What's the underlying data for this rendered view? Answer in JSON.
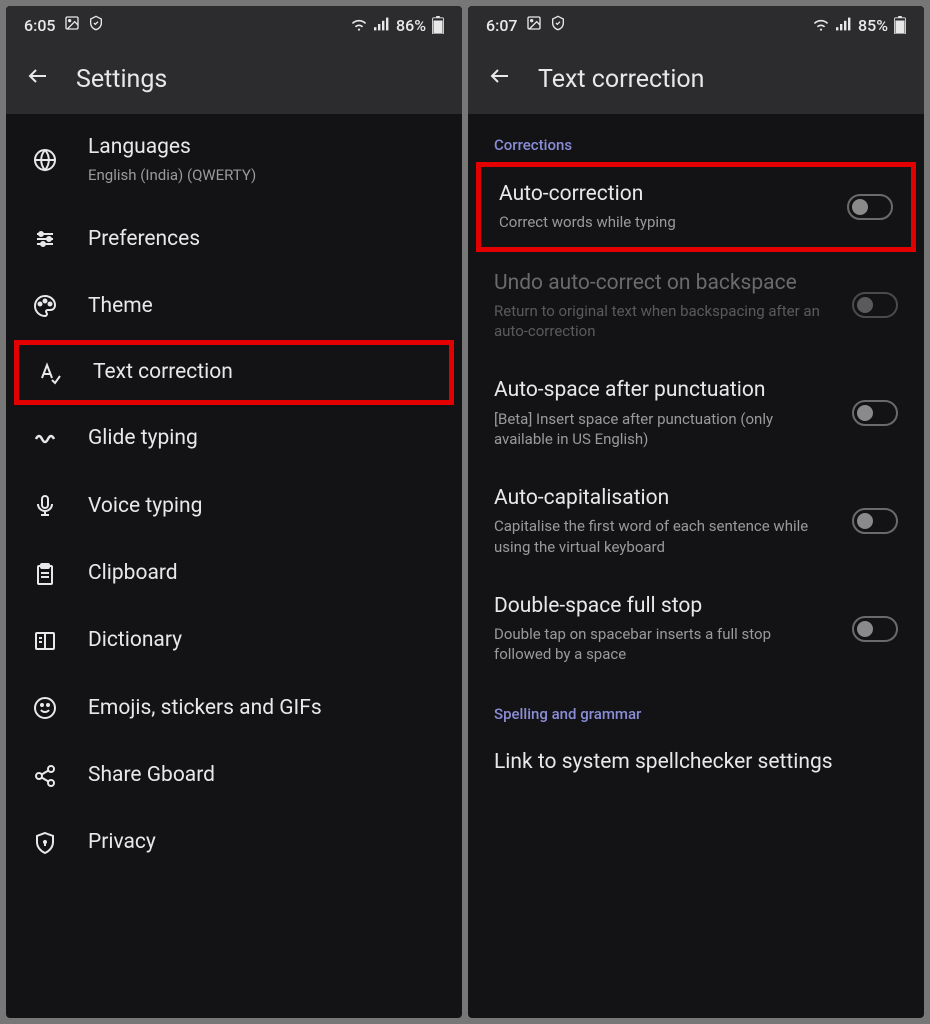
{
  "left": {
    "statusTime": "6:05",
    "batteryPct": "86%",
    "appTitle": "Settings",
    "items": [
      {
        "title": "Languages",
        "sub": "English (India) (QWERTY)",
        "icon": "globe"
      },
      {
        "title": "Preferences",
        "icon": "sliders"
      },
      {
        "title": "Theme",
        "icon": "palette"
      },
      {
        "title": "Text correction",
        "icon": "textcheck",
        "highlight": true
      },
      {
        "title": "Glide typing",
        "icon": "squiggle"
      },
      {
        "title": "Voice typing",
        "icon": "mic"
      },
      {
        "title": "Clipboard",
        "icon": "clipboard"
      },
      {
        "title": "Dictionary",
        "icon": "book"
      },
      {
        "title": "Emojis, stickers and GIFs",
        "icon": "emoji"
      },
      {
        "title": "Share Gboard",
        "icon": "share"
      },
      {
        "title": "Privacy",
        "icon": "shield"
      }
    ]
  },
  "right": {
    "statusTime": "6:07",
    "batteryPct": "85%",
    "appTitle": "Text correction",
    "section1": "Corrections",
    "rows": [
      {
        "title": "Auto-correction",
        "sub": "Correct words while typing",
        "highlight": true
      },
      {
        "title": "Undo auto-correct on backspace",
        "sub": "Return to original text when backspacing after an auto-correction",
        "disabled": true
      },
      {
        "title": "Auto-space after punctuation",
        "sub": "[Beta] Insert space after punctuation (only available in US English)"
      },
      {
        "title": "Auto-capitalisation",
        "sub": "Capitalise the first word of each sentence while using the virtual keyboard"
      },
      {
        "title": "Double-space full stop",
        "sub": "Double tap on spacebar inserts a full stop followed by a space"
      }
    ],
    "section2": "Spelling and grammar",
    "linkRow": "Link to system spellchecker settings"
  }
}
